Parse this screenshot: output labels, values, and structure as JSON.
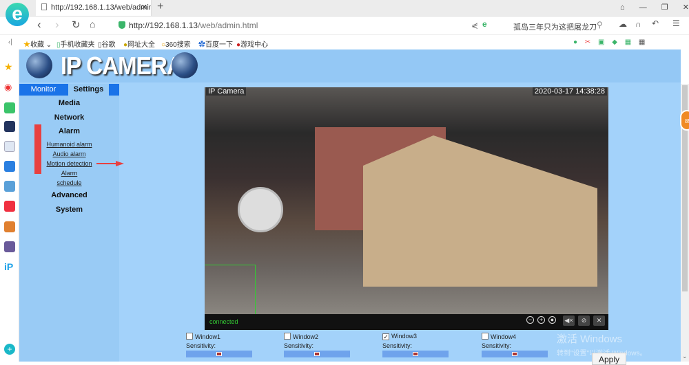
{
  "browser": {
    "tab_title": "http://192.168.1.13/web/admin",
    "url_host": "http://192.168.1.13",
    "url_path": "/web/admin.html",
    "search_text": "孤岛三年只为这把屠龙刀",
    "bookmarks": [
      "收藏",
      "手机收藏夹",
      "谷歌",
      "网址大全",
      "360搜索",
      "百度一下",
      "游戏中心"
    ]
  },
  "header": {
    "logo": "IP CAMERA"
  },
  "menu": {
    "tabs": [
      {
        "label": "Monitor",
        "active": false
      },
      {
        "label": "Settings",
        "active": true
      }
    ],
    "sections": [
      "Media",
      "Network",
      "Alarm",
      "Advanced",
      "System"
    ],
    "alarm_links": [
      "Humanoid alarm",
      "Audio alarm",
      "Motion detection",
      "Alarm",
      "schedule"
    ]
  },
  "video": {
    "overlay_title": "IP Camera",
    "timestamp": "2020-03-17 14:38:28",
    "status": "connected"
  },
  "windows": [
    {
      "label": "Window1",
      "checked": false,
      "sensitivity_label": "Sensitivity:",
      "sensitivity": 50
    },
    {
      "label": "Window2",
      "checked": false,
      "sensitivity_label": "Sensitivity:",
      "sensitivity": 50
    },
    {
      "label": "Window3",
      "checked": true,
      "sensitivity_label": "Sensitivity:",
      "sensitivity": 50
    },
    {
      "label": "Window4",
      "checked": false,
      "sensitivity_label": "Sensitivity:",
      "sensitivity": 50
    }
  ],
  "apply_label": "Apply",
  "watermark": {
    "line1": "激活 Windows",
    "line2": "转到\"设置\"以激活 Windows。"
  },
  "colors": {
    "page_bg": "#a3d2fa",
    "tab_active": "#1a73e8",
    "annotation_red": "#e84040"
  }
}
